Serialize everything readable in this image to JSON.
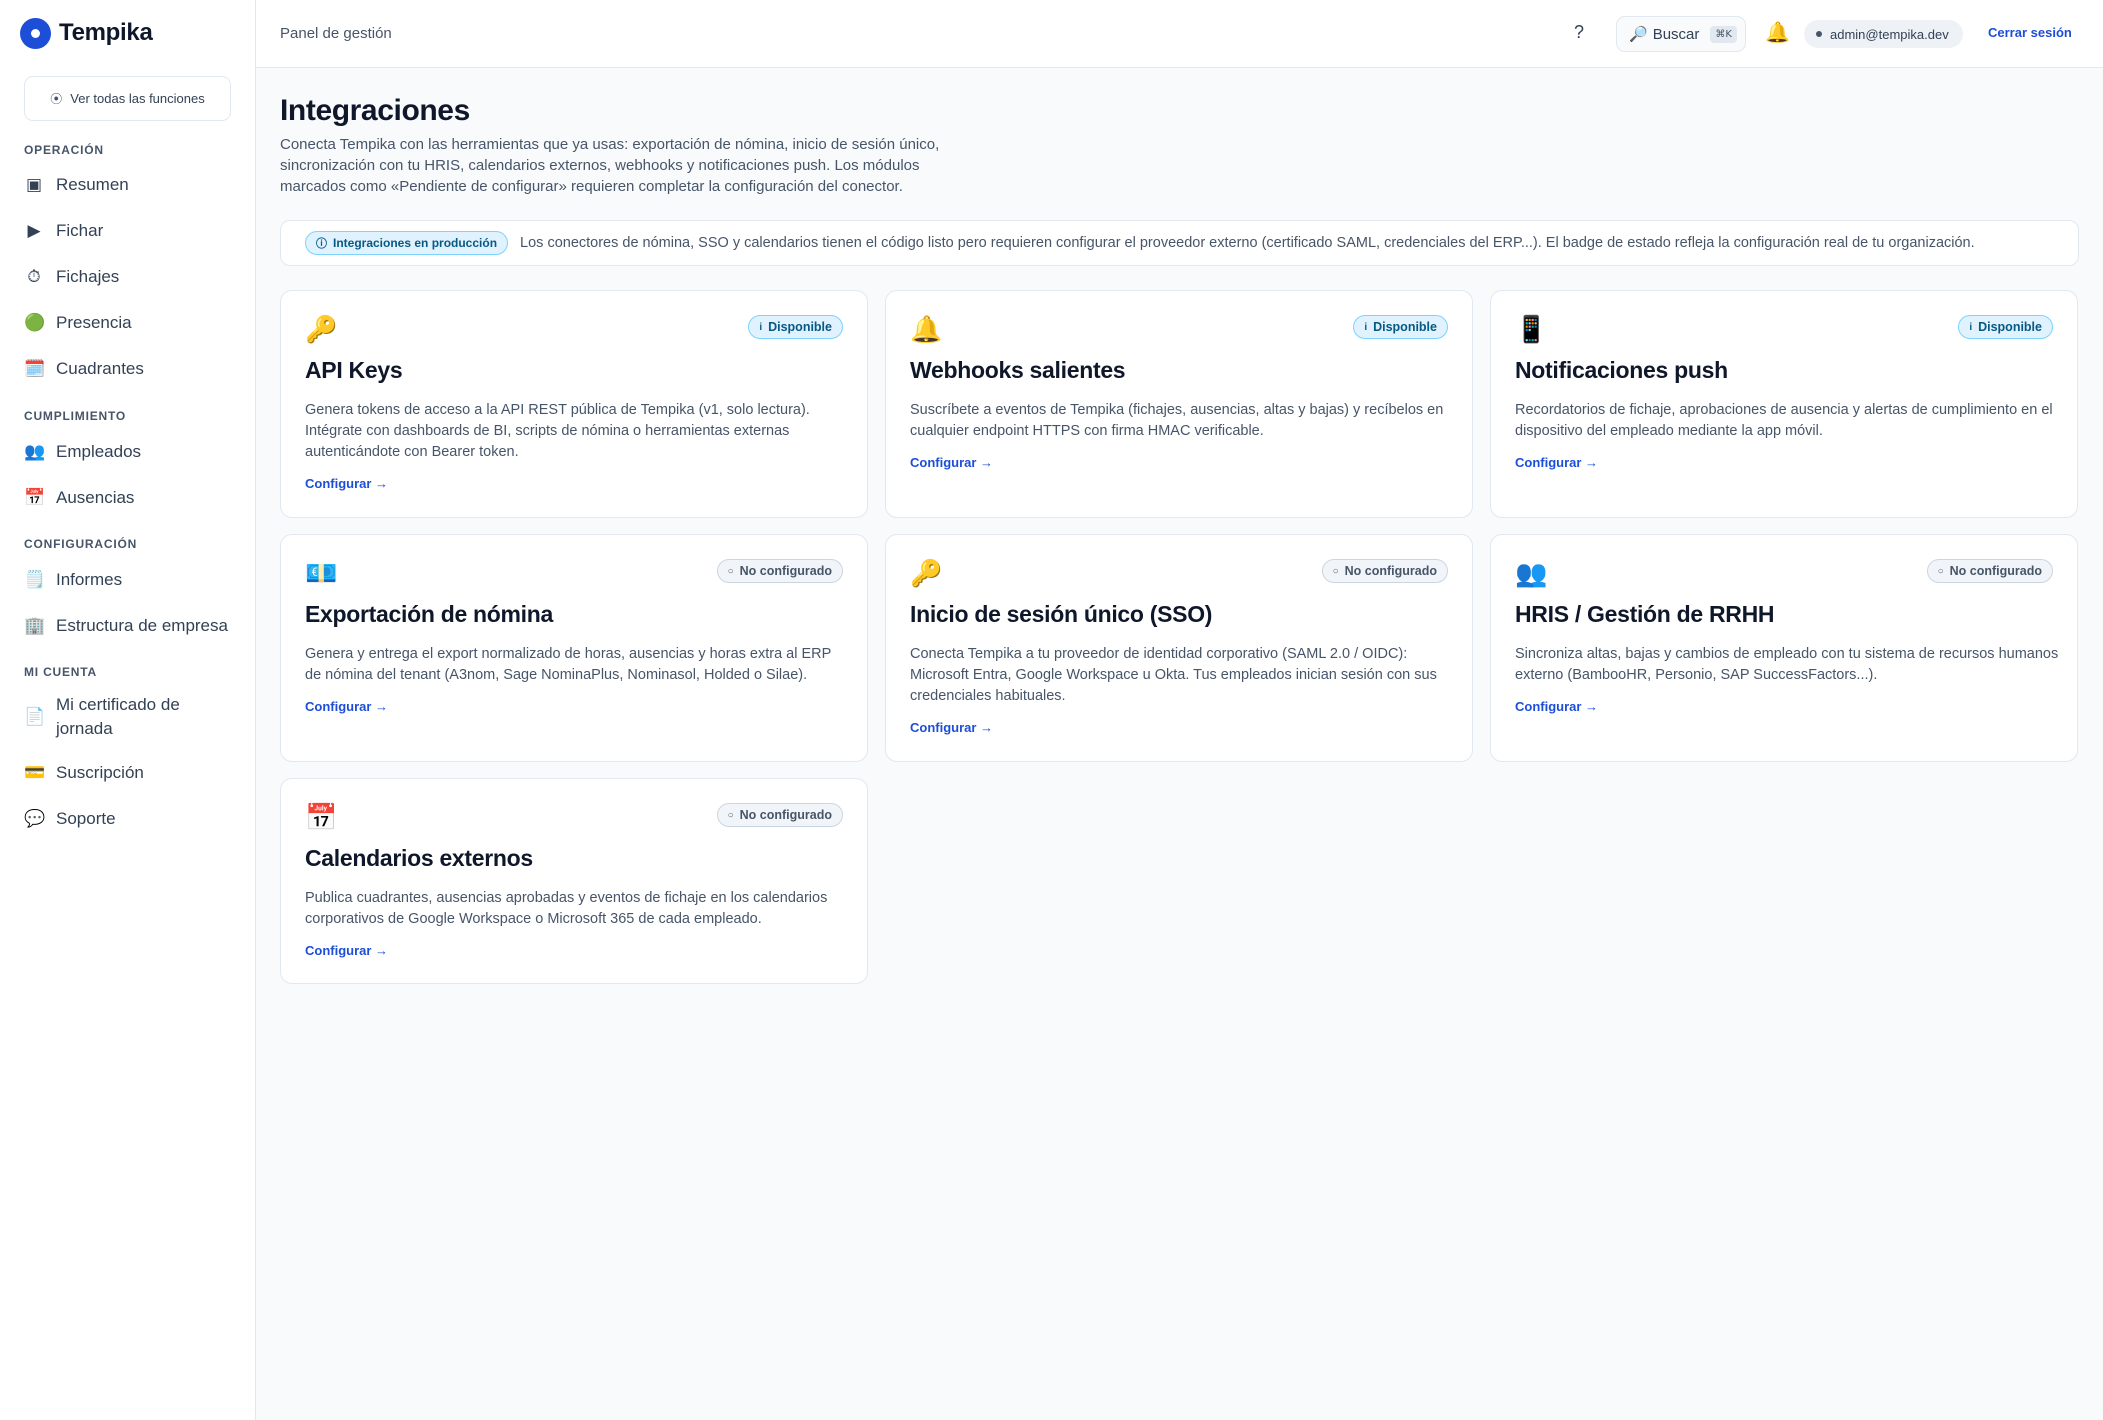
{
  "brand": {
    "name": "Tempika",
    "color": "#1d4ed8"
  },
  "sidebar": {
    "see_all": "Ver todas las funciones",
    "sections": [
      {
        "title": "OPERACIÓN",
        "items": [
          {
            "label": "Resumen",
            "icon": "▣",
            "icon_name": "square-icon"
          },
          {
            "label": "Fichar",
            "icon": "▶",
            "icon_name": "play-icon"
          },
          {
            "label": "Fichajes",
            "icon": "⏱",
            "icon_name": "stopwatch-icon"
          },
          {
            "label": "Presencia",
            "icon": "🟢",
            "icon_name": "green-circle-icon"
          },
          {
            "label": "Cuadrantes",
            "icon": "🗓️",
            "icon_name": "calendar-icon"
          }
        ]
      },
      {
        "title": "CUMPLIMIENTO",
        "items": [
          {
            "label": "Empleados",
            "icon": "👥",
            "icon_name": "people-icon"
          },
          {
            "label": "Ausencias",
            "icon": "📅",
            "icon_name": "calendar-date-icon"
          }
        ]
      },
      {
        "title": "CONFIGURACIÓN",
        "items": [
          {
            "label": "Informes",
            "icon": "🗒️",
            "icon_name": "notepad-icon"
          },
          {
            "label": "Estructura de empresa",
            "icon": "🏢",
            "icon_name": "building-icon"
          }
        ]
      },
      {
        "title": "MI CUENTA",
        "items": [
          {
            "label": "Mi certificado de jornada",
            "icon": "📄",
            "icon_name": "document-icon"
          },
          {
            "label": "Suscripción",
            "icon": "💳",
            "icon_name": "credit-card-icon"
          },
          {
            "label": "Soporte",
            "icon": "💬",
            "icon_name": "speech-bubble-icon"
          }
        ]
      }
    ]
  },
  "topbar": {
    "breadcrumb": "Panel de gestión",
    "help": "?",
    "search_label": "Buscar",
    "search_shortcut": "⌘K",
    "user_email": "admin@tempika.dev",
    "logout": "Cerrar sesión"
  },
  "page": {
    "title": "Integraciones",
    "description": "Conecta Tempika con las herramientas que ya usas: exportación de nómina, inicio de sesión único, sincronización con tu HRIS, calendarios externos, webhooks y notificaciones push. Los módulos marcados como «Pendiente de configurar» requieren completar la configuración del conector."
  },
  "banner": {
    "badge": "Integraciones en producción",
    "text": "Los conectores de nómina, SSO y calendarios tienen el código listo pero requieren configurar el proveedor externo (certificado SAML, credenciales del ERP...). El badge de estado refleja la configuración real de tu organización."
  },
  "cards": [
    {
      "icon": "🔑",
      "icon_name": "key-icon",
      "status": "Disponible",
      "status_kind": "ok",
      "status_symbol": "i",
      "title": "API Keys",
      "description": "Genera tokens de acceso a la API REST pública de Tempika (v1, solo lectura). Intégrate con dashboards de BI, scripts de nómina o herramientas externas autenticándote con Bearer token.",
      "link": "Configurar →"
    },
    {
      "icon": "🔔",
      "icon_name": "bell-icon",
      "status": "Disponible",
      "status_kind": "ok",
      "status_symbol": "i",
      "title": "Webhooks salientes",
      "description": "Suscríbete a eventos de Tempika (fichajes, ausencias, altas y bajas) y recíbelos en cualquier endpoint HTTPS con firma HMAC verificable.",
      "link": "Configurar →"
    },
    {
      "icon": "📱",
      "icon_name": "mobile-phone-icon",
      "status": "Disponible",
      "status_kind": "ok",
      "status_symbol": "i",
      "title": "Notificaciones push",
      "description": "Recordatorios de fichaje, aprobaciones de ausencia y alertas de cumplimiento en el dispositivo del empleado mediante la app móvil.",
      "link": "Configurar →"
    },
    {
      "icon": "💶",
      "icon_name": "euro-banknote-icon",
      "status": "No configurado",
      "status_kind": "no",
      "status_symbol": "○",
      "title": "Exportación de nómina",
      "description": "Genera y entrega el export normalizado de horas, ausencias y horas extra al ERP de nómina del tenant (A3nom, Sage NominaPlus, Nominasol, Holded o Silae).",
      "link": "Configurar →"
    },
    {
      "icon": "🔑",
      "icon_name": "key-icon",
      "status": "No configurado",
      "status_kind": "no",
      "status_symbol": "○",
      "title": "Inicio de sesión único (SSO)",
      "description": "Conecta Tempika a tu proveedor de identidad corporativo (SAML 2.0 / OIDC): Microsoft Entra, Google Workspace u Okta. Tus empleados inician sesión con sus credenciales habituales.",
      "link": "Configurar →"
    },
    {
      "icon": "👥",
      "icon_name": "people-icon",
      "status": "No configurado",
      "status_kind": "no",
      "status_symbol": "○",
      "title": "HRIS / Gestión de RRHH",
      "description": "Sincroniza altas, bajas y cambios de empleado con tu sistema de recursos humanos externo (BambooHR, Personio, SAP SuccessFactors...).",
      "link": "Configurar →"
    },
    {
      "icon": "📅",
      "icon_name": "calendar-date-icon",
      "status": "No configurado",
      "status_kind": "no",
      "status_symbol": "○",
      "title": "Calendarios externos",
      "description": "Publica cuadrantes, ausencias aprobadas y eventos de fichaje en los calendarios corporativos de Google Workspace o Microsoft 365 de cada empleado.",
      "link": "Configurar →"
    }
  ]
}
